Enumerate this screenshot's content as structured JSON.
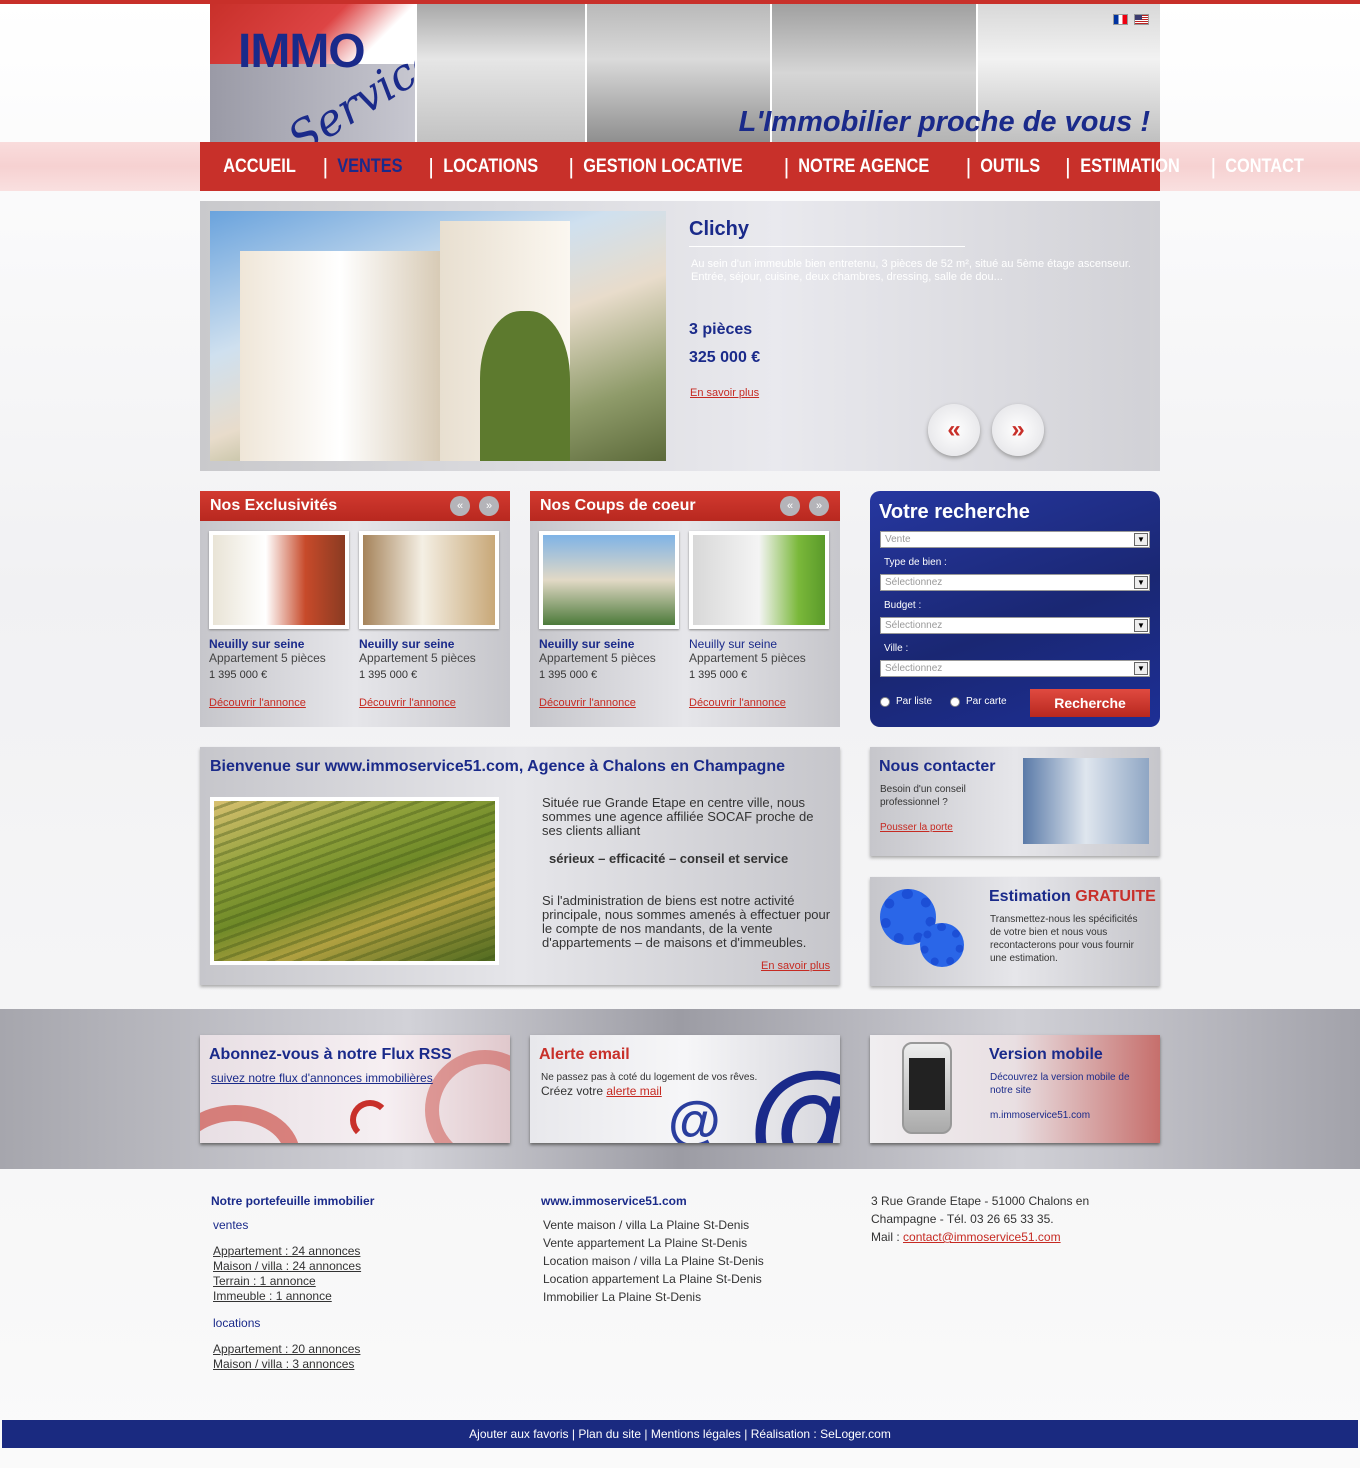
{
  "brand": {
    "logo_immo": "IMMO",
    "logo_service": "Service",
    "tagline": "L'Immobilier proche de vous !"
  },
  "nav": [
    "ACCUEIL",
    "VENTES",
    "LOCATIONS",
    "GESTION LOCATIVE",
    "NOTRE AGENCE",
    "OUTILS",
    "ESTIMATION",
    "CONTACT"
  ],
  "slider": {
    "title": "Clichy",
    "description": "Au sein d'un immeuble bien entretenu, 3 pièces de 52 m², situé au 5ème étage ascenseur. Entrée, séjour, cuisine, deux chambres, dressing, salle de dou...",
    "rooms": "3 pièces",
    "price": "325 000 €",
    "more": "En savoir plus",
    "prev": "«",
    "next": "»"
  },
  "exclusives": {
    "title": "Nos Exclusivités",
    "cards": [
      {
        "city": "Neuilly sur seine",
        "type": "Appartement 5 pièces",
        "price": "1 395 000 €",
        "link": "Découvrir l'annonce"
      },
      {
        "city": "Neuilly sur seine",
        "type": "Appartement 5 pièces",
        "price": "1 395 000 €",
        "link": "Découvrir l'annonce"
      }
    ]
  },
  "favorites": {
    "title": "Nos Coups de coeur",
    "cards": [
      {
        "city": "Neuilly sur seine",
        "type": "Appartement 5 pièces",
        "price": "1 395 000 €",
        "link": "Découvrir l'annonce"
      },
      {
        "city": "Neuilly sur seine",
        "type": "Appartement 5 pièces",
        "price": "1 395 000 €",
        "link": "Découvrir l'annonce"
      }
    ]
  },
  "mini_nav": {
    "prev": "«",
    "next": "»"
  },
  "search": {
    "title": "Votre recherche",
    "mode": "Vente",
    "type_label": "Type de bien :",
    "type_value": "Sélectionnez",
    "budget_label": "Budget :",
    "budget_value": "Sélectionnez",
    "city_label": "Ville :",
    "city_value": "Sélectionnez",
    "radio_list": "Par liste",
    "radio_map": "Par carte",
    "button": "Recherche"
  },
  "welcome": {
    "title": "Bienvenue sur www.immoservice51.com, Agence à Chalons en Champagne",
    "p1": "Située rue Grande Etape en centre ville, nous sommes une agence affiliée SOCAF proche de ses clients alliant",
    "p2": "sérieux – efficacité – conseil et service",
    "p3": "Si l'administration de biens est notre activité principale, nous sommes amenés à effectuer pour le compte de nos mandants, de la vente d'appartements –  de maisons et d'immeubles.",
    "more": "En savoir plus"
  },
  "contact": {
    "title": "Nous contacter",
    "text": "Besoin d'un conseil professionnel ?",
    "link": "Pousser la porte"
  },
  "estimation": {
    "title": "Estimation",
    "title_accent": "GRATUITE",
    "text": "Transmettez-nous les spécificités de votre bien et nous vous recontacterons pour vous fournir une estimation."
  },
  "promos": {
    "rss": {
      "title": "Abonnez-vous à notre Flux RSS",
      "link": "suivez notre flux d'annonces immobilières"
    },
    "alert": {
      "title": "Alerte email",
      "text1": "Ne passez pas à coté du logement de vos rêves.",
      "text2": "Créez votre",
      "link": "alerte mail"
    },
    "mobile": {
      "title": "Version mobile",
      "text": "Découvrez la version mobile de notre site",
      "url": "m.immoservice51.com"
    }
  },
  "footer": {
    "portfolio_title": "Notre portefeuille immobilier",
    "sales_label": "ventes",
    "sales": [
      "Appartement : 24 annonces",
      "Maison / villa : 24 annonces",
      "Terrain : 1 annonce",
      "Immeuble : 1 annonce"
    ],
    "rentals_label": "locations",
    "rentals": [
      "Appartement : 20 annonces",
      "Maison / villa : 3 annonces"
    ],
    "site_title": "www.immoservice51.com",
    "site_links": [
      "Vente maison / villa La Plaine St-Denis",
      "Vente appartement La Plaine St-Denis",
      "Location maison / villa La Plaine St-Denis",
      "Location appartement La Plaine St-Denis",
      "Immobilier La Plaine St-Denis"
    ],
    "address": "3 Rue Grande Etape - 51000 Chalons en Champagne - Tél. 03 26 65 33 35.",
    "mail_label": "Mail :",
    "mail": "contact@immoservice51.com"
  },
  "bottom": [
    "Ajouter aux favoris",
    "Plan du site",
    "Mentions légales",
    "Réalisation : SeLoger.com"
  ],
  "colors": {
    "brand_red": "#c8302a",
    "brand_blue": "#1a2a8a"
  }
}
